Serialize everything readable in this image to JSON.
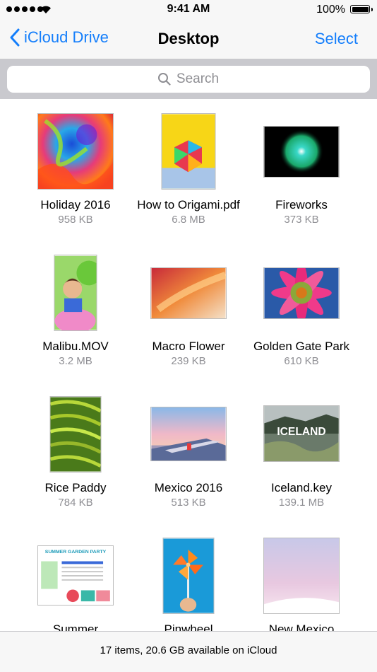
{
  "status_bar": {
    "time": "9:41 AM",
    "battery": "100%",
    "battery_level": 1.0
  },
  "nav": {
    "back_label": "iCloud Drive",
    "title": "Desktop",
    "select_label": "Select",
    "accent_color": "#147efb"
  },
  "search": {
    "placeholder": "Search"
  },
  "files": [
    {
      "name": "Holiday 2016",
      "size": "958 KB",
      "thumbnail": "colorful-paint-artwork"
    },
    {
      "name": "How to Origami.pdf",
      "size": "6.8 MB",
      "thumbnail": "origami-polyhedron-on-yellow"
    },
    {
      "name": "Fireworks",
      "size": "373 KB",
      "thumbnail": "green-fireworks-burst"
    },
    {
      "name": "Malibu.MOV",
      "size": "3.2 MB",
      "thumbnail": "child-with-balloons"
    },
    {
      "name": "Macro Flower",
      "size": "239 KB",
      "thumbnail": "blurred-orange-petal"
    },
    {
      "name": "Golden Gate Park",
      "size": "610 KB",
      "thumbnail": "pink-daisy-flower"
    },
    {
      "name": "Rice Paddy",
      "size": "784 KB",
      "thumbnail": "green-rice-terraces"
    },
    {
      "name": "Mexico 2016",
      "size": "513 KB",
      "thumbnail": "airplane-wing-sunset"
    },
    {
      "name": "Iceland.key",
      "size": "139.1 MB",
      "thumbnail": "iceland-landscape",
      "thumbnail_text": "ICELAND"
    },
    {
      "name": "Summer",
      "size": "",
      "thumbnail": "spreadsheet-document",
      "thumbnail_text": "SUMMER GARDEN PARTY"
    },
    {
      "name": "Pinwheel",
      "size": "",
      "thumbnail": "orange-pinwheel-on-blue"
    },
    {
      "name": "New Mexico",
      "size": "",
      "thumbnail": "pastel-desert-sky"
    }
  ],
  "footer": {
    "text": "17 items, 20.6 GB available on iCloud"
  }
}
